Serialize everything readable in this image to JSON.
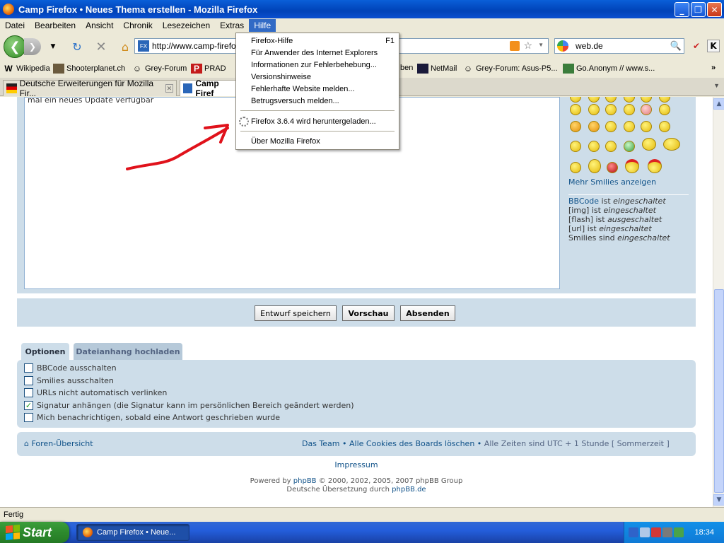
{
  "window": {
    "title": "Camp Firefox • Neues Thema erstellen - Mozilla Firefox",
    "min_label": "_",
    "max_label": "❐",
    "close_label": "✕"
  },
  "menubar": {
    "items": [
      "Datei",
      "Bearbeiten",
      "Ansicht",
      "Chronik",
      "Lesezeichen",
      "Extras",
      "Hilfe"
    ]
  },
  "navbar": {
    "url": "http://www.camp-firefo",
    "search_value": "web.de",
    "favicon_text": "FX"
  },
  "bookmarks": {
    "items": [
      "Wikipedia",
      "Shooterplanet.ch",
      "Grey-Forum",
      "PRAD",
      "ben",
      "NetMail",
      "Grey-Forum: Asus-P5...",
      "Go.Anonym // www.s..."
    ],
    "overflow": "»"
  },
  "tabs": {
    "items": [
      "Deutsche Erweiterungen für Mozilla Fir...",
      "Camp Firef"
    ]
  },
  "help_menu": {
    "items": [
      {
        "label": "Firefox-Hilfe",
        "shortcut": "F1"
      },
      {
        "label": "Für Anwender des Internet Explorers",
        "shortcut": ""
      },
      {
        "label": "Informationen zur Fehlerbehebung...",
        "shortcut": ""
      },
      {
        "label": "Versionshinweise",
        "shortcut": ""
      },
      {
        "label": "Fehlerhafte Website melden...",
        "shortcut": ""
      },
      {
        "label": "Betrugsversuch melden...",
        "shortcut": ""
      },
      {
        "label": "Firefox 3.6.4 wird heruntergeladen...",
        "shortcut": ""
      },
      {
        "label": "Über Mozilla Firefox",
        "shortcut": ""
      }
    ]
  },
  "editor": {
    "text_fragment": "mal ein neues Update verfügbar"
  },
  "sidebar": {
    "more_smilies": "Mehr Smilies anzeigen",
    "bbcode_link": "BBCode",
    "bbcode_rest": " ist ",
    "bbcode_state": "eingeschaltet",
    "img": "[img] ist ",
    "img_state": "eingeschaltet",
    "flash": "[flash] ist ",
    "flash_state": "ausgeschaltet",
    "url": "[url] ist ",
    "url_state": "eingeschaltet",
    "smilies": "Smilies sind ",
    "smilies_state": "eingeschaltet"
  },
  "buttons": {
    "draft": "Entwurf speichern",
    "preview": "Vorschau",
    "submit": "Absenden"
  },
  "option_tabs": {
    "options": "Optionen",
    "attachment": "Dateianhang hochladen"
  },
  "options": [
    {
      "label": "BBCode ausschalten",
      "checked": false
    },
    {
      "label": "Smilies ausschalten",
      "checked": false
    },
    {
      "label": "URLs nicht automatisch verlinken",
      "checked": false
    },
    {
      "label": "Signatur anhängen (die Signatur kann im persönlichen Bereich geändert werden)",
      "checked": true
    },
    {
      "label": "Mich benachrichtigen, sobald eine Antwort geschrieben wurde",
      "checked": false
    }
  ],
  "footer": {
    "forum_index": "Foren-Übersicht",
    "team": "Das Team",
    "bullet": "•",
    "delete_cookies": "Alle Cookies des Boards löschen",
    "timezone": "Alle Zeiten sind UTC + 1 Stunde [ Sommerzeit ]",
    "impressum": "Impressum",
    "powered_prefix": "Powered by ",
    "powered_link": "phpBB",
    "powered_suffix": " © 2000, 2002, 2005, 2007 phpBB Group",
    "translation_prefix": "Deutsche Übersetzung durch ",
    "translation_link": "phpBB.de"
  },
  "statusbar": {
    "text": "Fertig"
  },
  "taskbar": {
    "start": "Start",
    "task": "Camp Firefox • Neue...",
    "clock": "18:34"
  },
  "colors": {
    "accent_menu": "#316ac5",
    "phpbb_panel": "#cddde9",
    "link": "#105289",
    "annotation_arrow": "#e0121b"
  }
}
